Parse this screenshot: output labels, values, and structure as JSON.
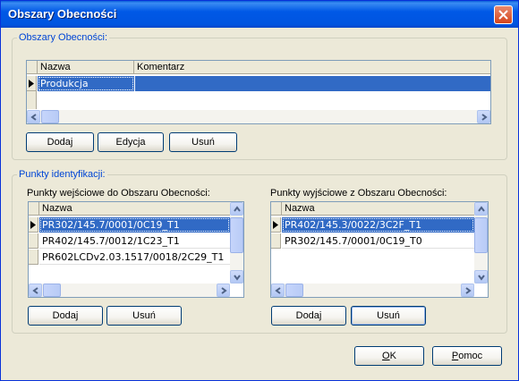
{
  "window": {
    "title": "Obszary Obecności"
  },
  "areas_group": {
    "title": "Obszary Obecności:",
    "columns": [
      "Nazwa",
      "Komentarz"
    ],
    "rows": [
      {
        "nazwa": "Produkcja",
        "komentarz": ""
      }
    ],
    "buttons": {
      "add": "Dodaj",
      "edit": "Edycja",
      "delete": "Usuń"
    }
  },
  "points_group": {
    "title": "Punkty identyfikacji:",
    "entry": {
      "label": "Punkty wejściowe do Obszaru Obecności:",
      "column": "Nazwa",
      "rows": [
        "PR302/145.7/0001/0C19_T1",
        "PR402/145.7/0012/1C23_T1",
        "PR602LCDv2.03.1517/0018/2C29_T1"
      ],
      "buttons": {
        "add": "Dodaj",
        "delete": "Usuń"
      }
    },
    "exit": {
      "label": "Punkty wyjściowe z Obszaru Obecności:",
      "column": "Nazwa",
      "rows": [
        "PR402/145.3/0022/3C2F_T1",
        "PR302/145.7/0001/0C19_T0"
      ],
      "buttons": {
        "add": "Dodaj",
        "delete": "Usuń"
      }
    }
  },
  "footer": {
    "ok_label": "K",
    "ok_mnemonic": "O",
    "help_label": "omoc",
    "help_mnemonic": "P"
  },
  "colors": {
    "title_bar": "#0058e6",
    "selection": "#316ac5",
    "group_label": "#0046d5",
    "face": "#ece9d8"
  }
}
